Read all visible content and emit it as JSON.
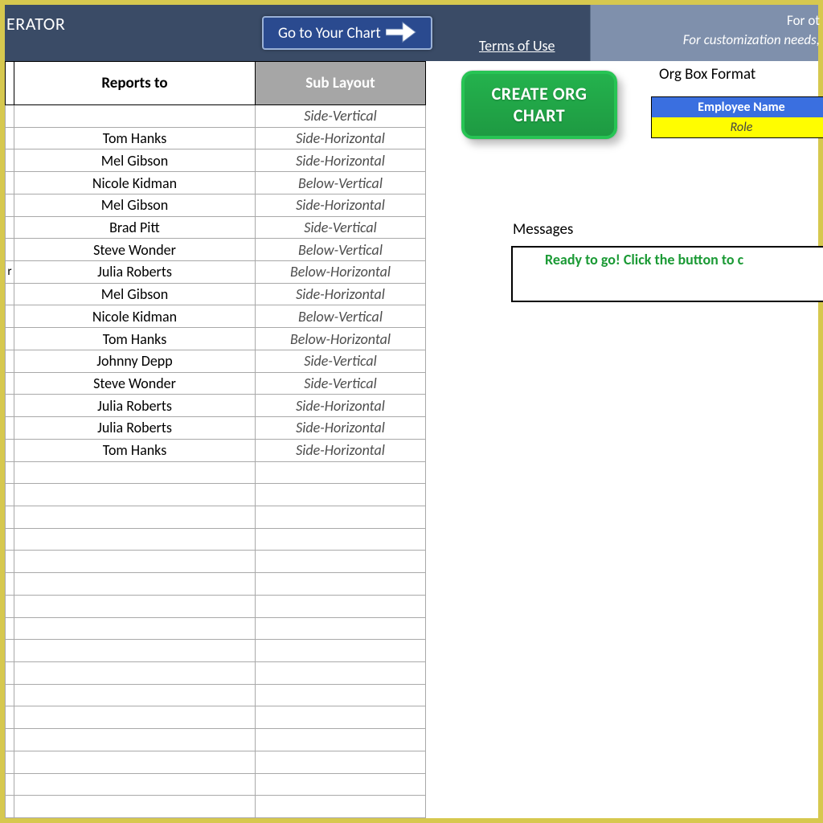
{
  "header": {
    "title_fragment": "ERATOR",
    "goto_chart_label": "Go to Your Chart",
    "terms_link": "Terms of Use",
    "right_line1": "For ot",
    "right_line2": "For customization needs,"
  },
  "table": {
    "cols": {
      "reports_to": "Reports to",
      "sub_layout": "Sub Layout"
    },
    "rows": [
      {
        "reports_to": "",
        "sub_layout": "Side-Vertical"
      },
      {
        "reports_to": "Tom Hanks",
        "sub_layout": "Side-Horizontal"
      },
      {
        "reports_to": "Mel Gibson",
        "sub_layout": "Side-Horizontal"
      },
      {
        "reports_to": "Nicole Kidman",
        "sub_layout": "Below-Vertical"
      },
      {
        "reports_to": "Mel Gibson",
        "sub_layout": "Side-Horizontal"
      },
      {
        "reports_to": "Brad Pitt",
        "sub_layout": "Side-Vertical"
      },
      {
        "reports_to": "Steve Wonder",
        "sub_layout": "Below-Vertical"
      },
      {
        "leftfrag": "r",
        "reports_to": "Julia Roberts",
        "sub_layout": "Below-Horizontal"
      },
      {
        "reports_to": "Mel Gibson",
        "sub_layout": "Side-Horizontal"
      },
      {
        "reports_to": "Nicole Kidman",
        "sub_layout": "Below-Vertical"
      },
      {
        "reports_to": "Tom Hanks",
        "sub_layout": "Below-Horizontal"
      },
      {
        "reports_to": "Johnny Depp",
        "sub_layout": "Side-Vertical"
      },
      {
        "reports_to": "Steve Wonder",
        "sub_layout": "Side-Vertical"
      },
      {
        "reports_to": "Julia Roberts",
        "sub_layout": "Side-Horizontal"
      },
      {
        "reports_to": "Julia Roberts",
        "sub_layout": "Side-Horizontal"
      },
      {
        "reports_to": "Tom Hanks",
        "sub_layout": "Side-Horizontal"
      },
      {
        "reports_to": "",
        "sub_layout": ""
      },
      {
        "reports_to": "",
        "sub_layout": ""
      },
      {
        "reports_to": "",
        "sub_layout": ""
      },
      {
        "reports_to": "",
        "sub_layout": ""
      },
      {
        "reports_to": "",
        "sub_layout": ""
      },
      {
        "reports_to": "",
        "sub_layout": ""
      },
      {
        "reports_to": "",
        "sub_layout": ""
      },
      {
        "reports_to": "",
        "sub_layout": ""
      },
      {
        "reports_to": "",
        "sub_layout": ""
      },
      {
        "reports_to": "",
        "sub_layout": ""
      },
      {
        "reports_to": "",
        "sub_layout": ""
      },
      {
        "reports_to": "",
        "sub_layout": ""
      },
      {
        "reports_to": "",
        "sub_layout": ""
      },
      {
        "reports_to": "",
        "sub_layout": ""
      },
      {
        "reports_to": "",
        "sub_layout": ""
      },
      {
        "reports_to": "",
        "sub_layout": ""
      }
    ]
  },
  "create_btn": {
    "line1": "CREATE ORG",
    "line2": "CHART"
  },
  "orgbox": {
    "title": "Org Box Format",
    "emp": "Employee Name",
    "role": "Role"
  },
  "messages": {
    "label": "Messages",
    "text": "Ready to go! Click the button to c"
  }
}
